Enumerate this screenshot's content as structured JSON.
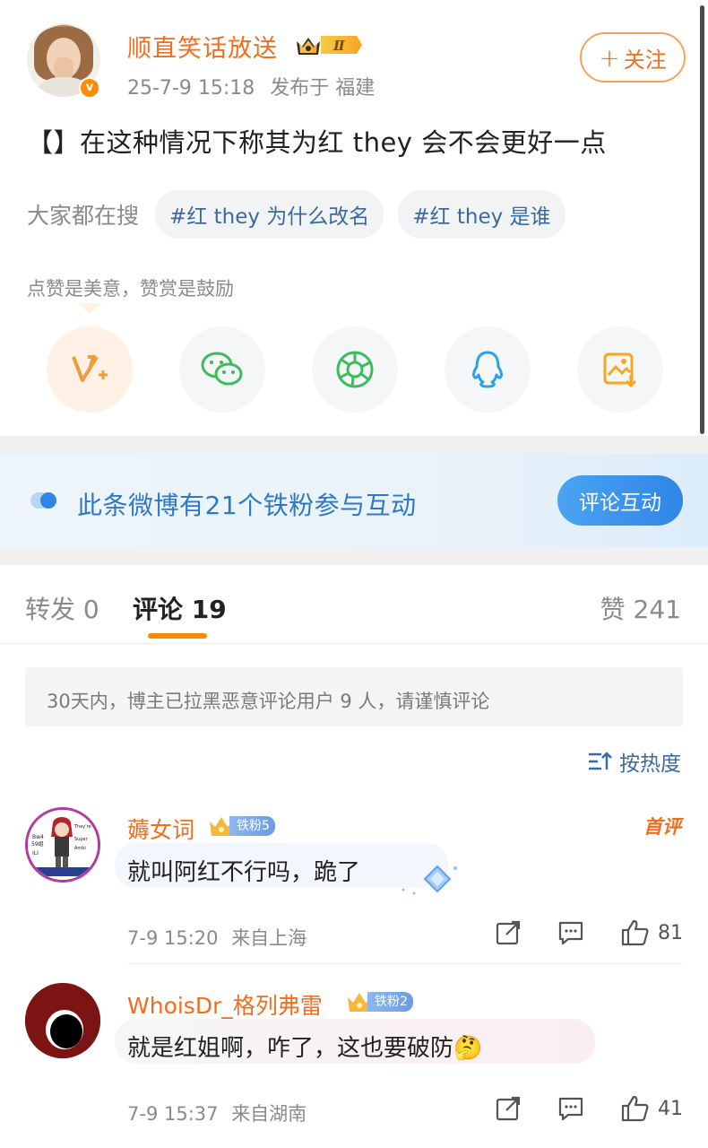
{
  "post": {
    "author": "顺直笑话放送",
    "level_badge": "Ⅱ",
    "verified_mark": "v",
    "timestamp": "25-7-9 15:18",
    "location": "发布于 福建",
    "follow_label": "关注",
    "follow_plus": "+",
    "text": "【】在这种情况下称其为红 they 会不会更好一点",
    "search_label": "大家都在搜",
    "search_tags": [
      "#红 they 为什么改名",
      "#红 they 是谁"
    ],
    "like_note": "点赞是美意，赞赏是鼓励",
    "share_icons": [
      "v-plus-icon",
      "wechat-icon",
      "moments-icon",
      "qq-icon",
      "save-image-icon"
    ]
  },
  "fan_banner": {
    "text": "此条微博有21个铁粉参与互动",
    "button": "评论互动"
  },
  "tabs": {
    "repost": "转发 0",
    "comments": "评论 19",
    "likes": "赞 241"
  },
  "notice": "30天内，博主已拉黑恶意评论用户 9 人，请谨慎评论",
  "sort_label": "按热度",
  "comments": [
    {
      "name": "薅女词",
      "fan_level": "铁粉5",
      "first_label": "首评",
      "text": "就叫阿红不行吗，跪了",
      "time": "7-9 15:20",
      "location": "来自上海",
      "likes": "81",
      "avatar_caption_lines": [
        "They're",
        "Bw4",
        "59组",
        "ILI",
        "Super",
        "Ambi"
      ]
    },
    {
      "name": "WhoisDr_格列弗雷",
      "fan_level": "铁粉2",
      "text": "就是红姐啊，咋了，这也要破防",
      "emoji": "🤔",
      "time": "7-9 15:37",
      "location": "来自湖南",
      "likes": "41"
    }
  ],
  "colors": {
    "accent_orange": "#f26d1e",
    "link_blue": "#3a6aa0",
    "fan_blue": "#2f78c4",
    "meta_gray": "#8a8a8a"
  }
}
